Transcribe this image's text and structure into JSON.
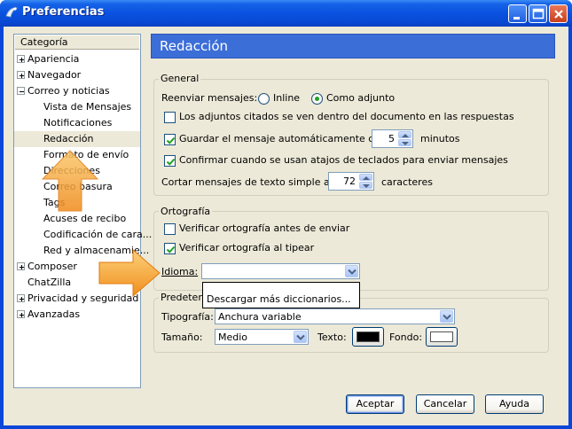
{
  "window": {
    "title": "Preferencias"
  },
  "sidebar": {
    "header": "Categoría",
    "items": [
      {
        "label": "Apariencia",
        "expandable": true
      },
      {
        "label": "Navegador",
        "expandable": true
      },
      {
        "label": "Correo y noticias",
        "expandable": true,
        "expanded": true
      },
      {
        "label": "Vista de Mensajes"
      },
      {
        "label": "Notificaciones"
      },
      {
        "label": "Redacción",
        "selected": true
      },
      {
        "label": "Formato de envío"
      },
      {
        "label": "Direcciones"
      },
      {
        "label": "Correo basura"
      },
      {
        "label": "Tags"
      },
      {
        "label": "Acuses de recibo"
      },
      {
        "label": "Codificación de cara..."
      },
      {
        "label": "Red y almacenamie..."
      },
      {
        "label": "Composer",
        "expandable": true
      },
      {
        "label": "ChatZilla"
      },
      {
        "label": "Privacidad y seguridad",
        "expandable": true
      },
      {
        "label": "Avanzadas",
        "expandable": true
      }
    ]
  },
  "panel": {
    "title": "Redacción"
  },
  "general": {
    "legend": "General",
    "forward_label": "Reenviar mensajes:",
    "forward_inline": "Inline",
    "forward_attach": "Como adjunto",
    "cb_quoted": "Los adjuntos citados se ven dentro del documento en las respuestas",
    "cb_autosave": "Guardar el mensaje automáticamente cada",
    "autosave_value": "5",
    "autosave_unit": "minutos",
    "cb_shortcut": "Confirmar cuando se usan atajos de teclados para enviar mensajes",
    "wrap_label": "Cortar mensajes de texto simple a los",
    "wrap_value": "72",
    "wrap_unit": "caracteres"
  },
  "spelling": {
    "legend": "Ortografía",
    "cb_before_send": "Verificar ortografía antes de enviar",
    "cb_as_type": "Verificar ortografía al tipear",
    "language_label": "Idioma:",
    "language_value": "",
    "dropdown_item": "Descargar más diccionarios..."
  },
  "defaults": {
    "legend": "Predeterm",
    "font_label": "Tipografía:",
    "font_value": "Anchura variable",
    "size_label": "Tamaño:",
    "size_value": "Medio",
    "text_label": "Texto:",
    "bg_label": "Fondo:",
    "text_color": "#000000",
    "bg_color": "#ffffff"
  },
  "buttons": {
    "accept": "Aceptar",
    "cancel": "Cancelar",
    "help": "Ayuda"
  },
  "colors": {
    "title_bar": "#0a52e0",
    "panel_header": "#3c6ed8",
    "face": "#ece9d8",
    "pointer_arrow": "#f5a623"
  }
}
